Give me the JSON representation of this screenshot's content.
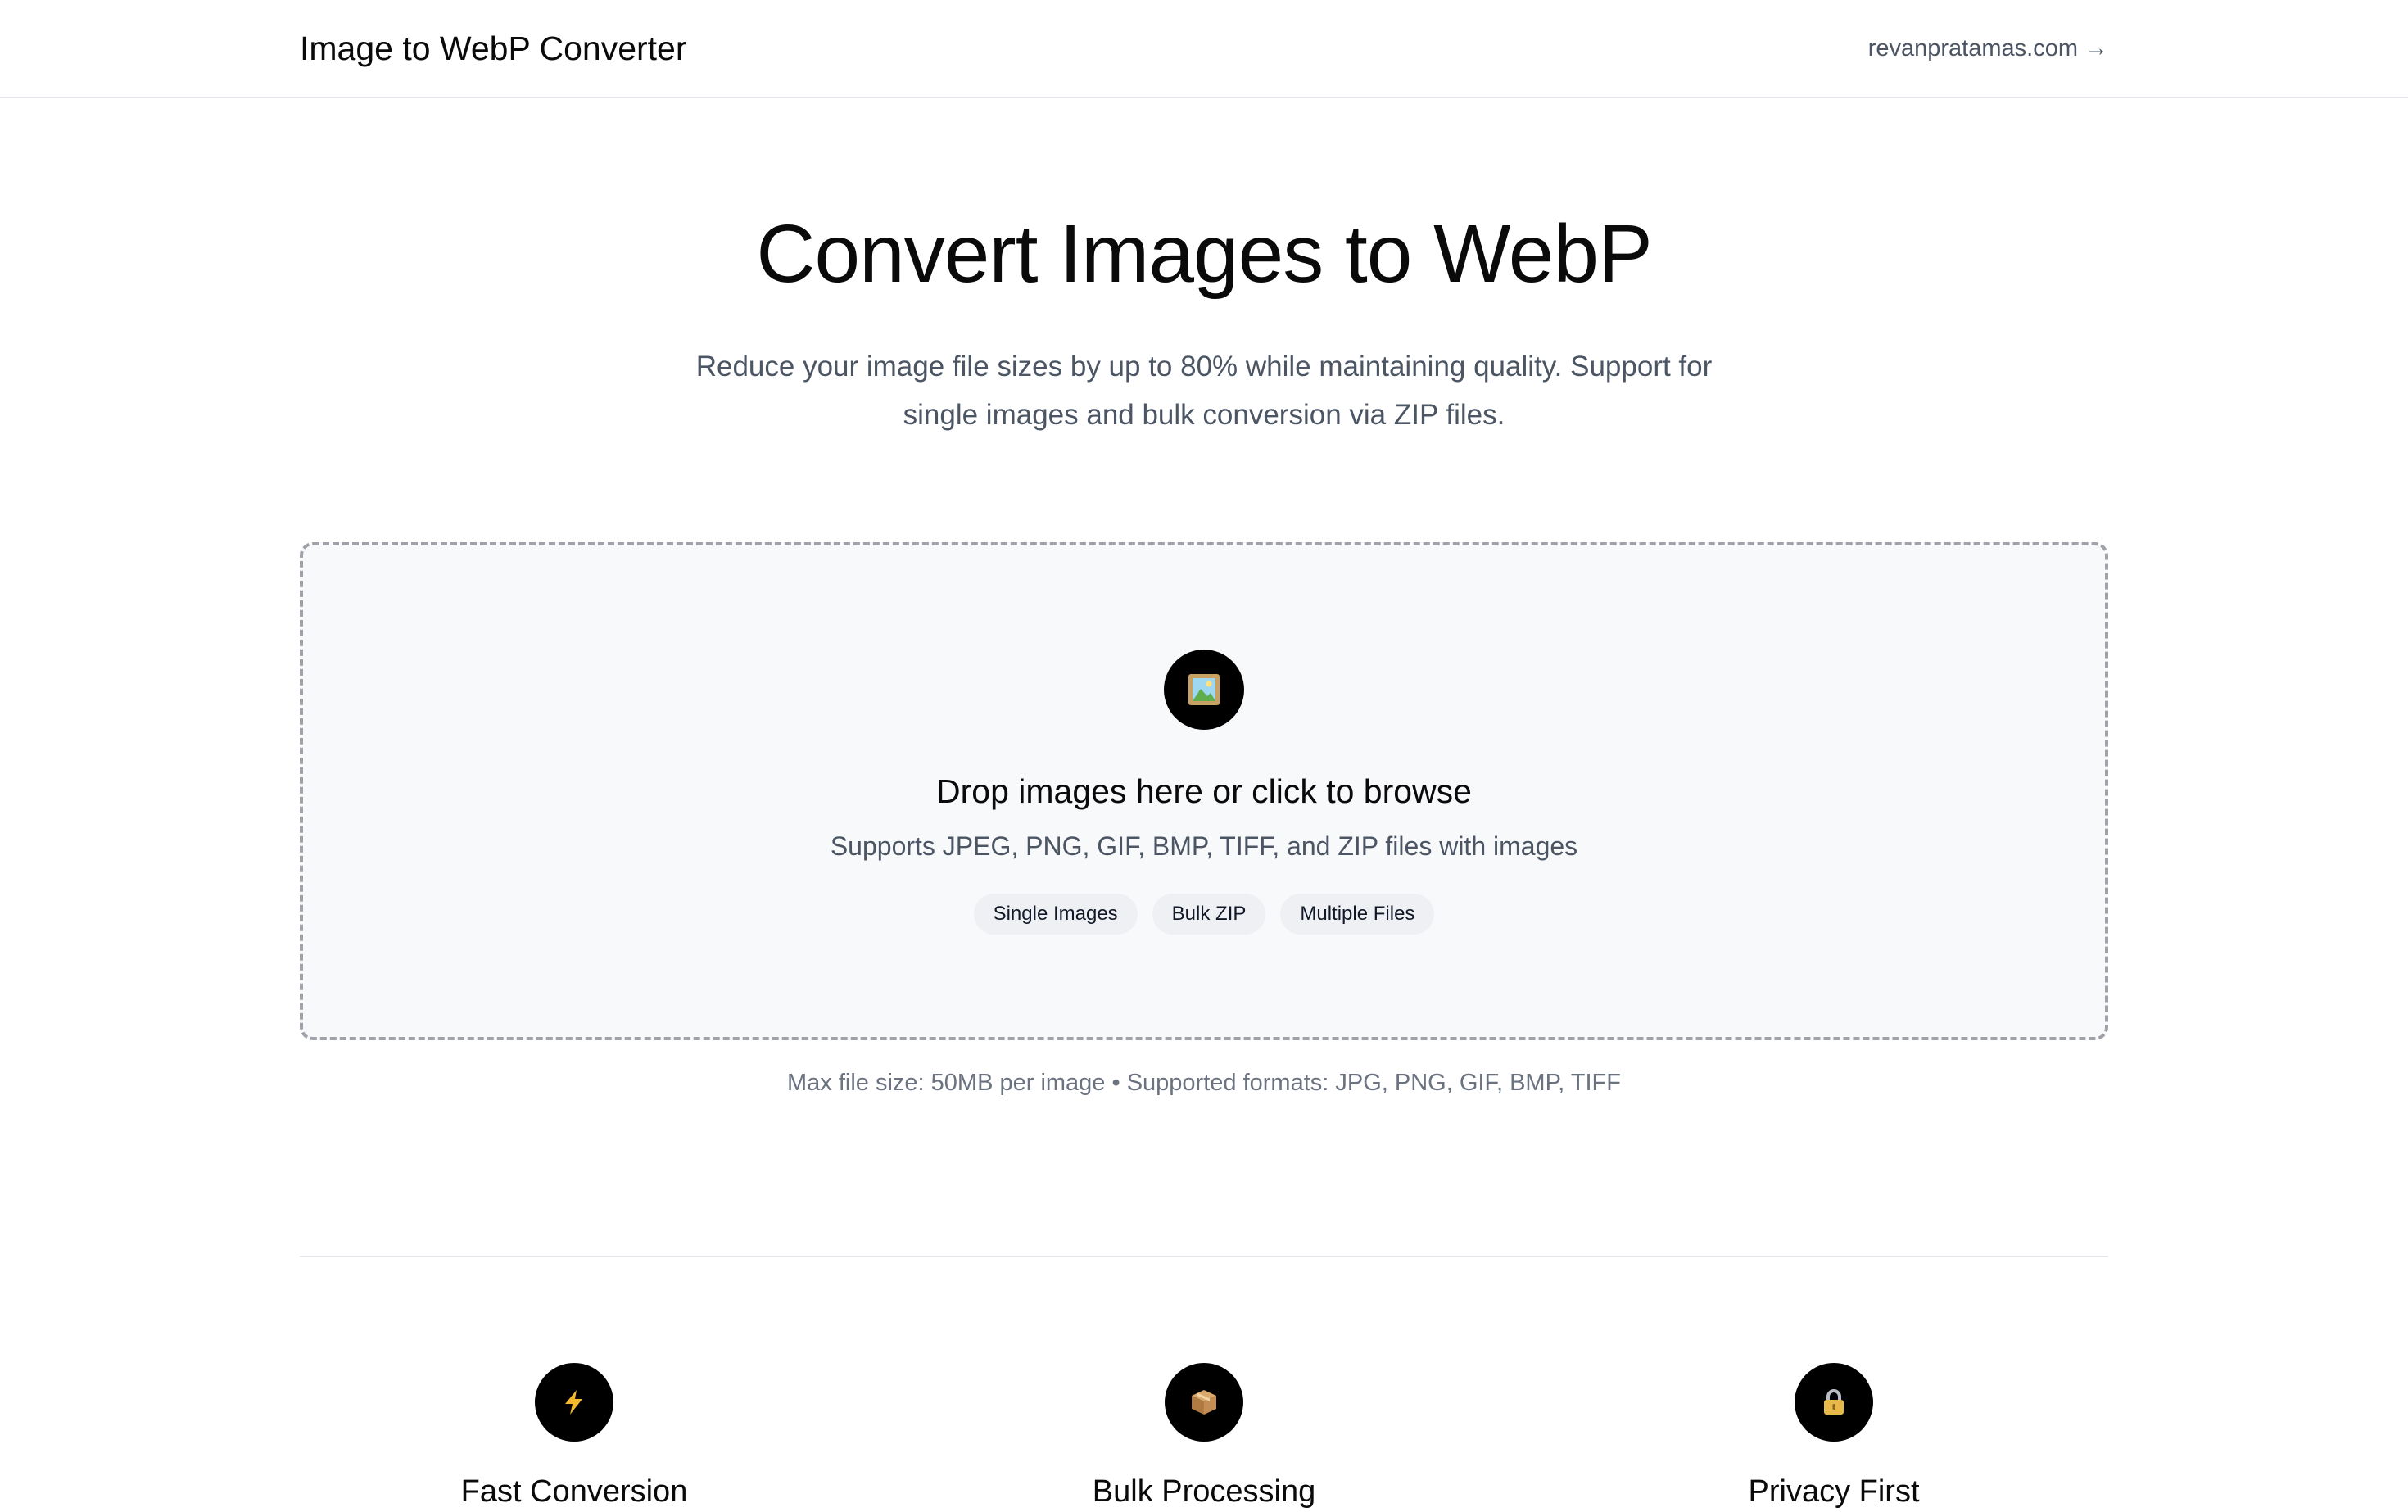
{
  "header": {
    "brand": "Image to WebP Converter",
    "site_link": "revanpratamas.com",
    "site_link_arrow": "→"
  },
  "hero": {
    "title": "Convert Images to WebP",
    "subtitle": "Reduce your image file sizes by up to 80% while maintaining quality. Support for single images and bulk conversion via ZIP files."
  },
  "dropzone": {
    "icon": "image-frame-icon",
    "title": "Drop images here or click to browse",
    "subtitle": "Supports JPEG, PNG, GIF, BMP, TIFF, and ZIP files with images",
    "chips": [
      "Single Images",
      "Bulk ZIP",
      "Multiple Files"
    ]
  },
  "limits_text": "Max file size: 50MB per image • Supported formats: JPG, PNG, GIF, BMP, TIFF",
  "features": [
    {
      "icon": "lightning-icon",
      "title": "Fast Conversion"
    },
    {
      "icon": "package-icon",
      "title": "Bulk Processing"
    },
    {
      "icon": "lock-icon",
      "title": "Privacy First"
    }
  ],
  "colors": {
    "text": "#0a0a0a",
    "muted": "#4b5563",
    "dropzone_bg": "#f8f9fb",
    "dropzone_border": "#a1a1aa",
    "icon_bg": "#000000"
  }
}
